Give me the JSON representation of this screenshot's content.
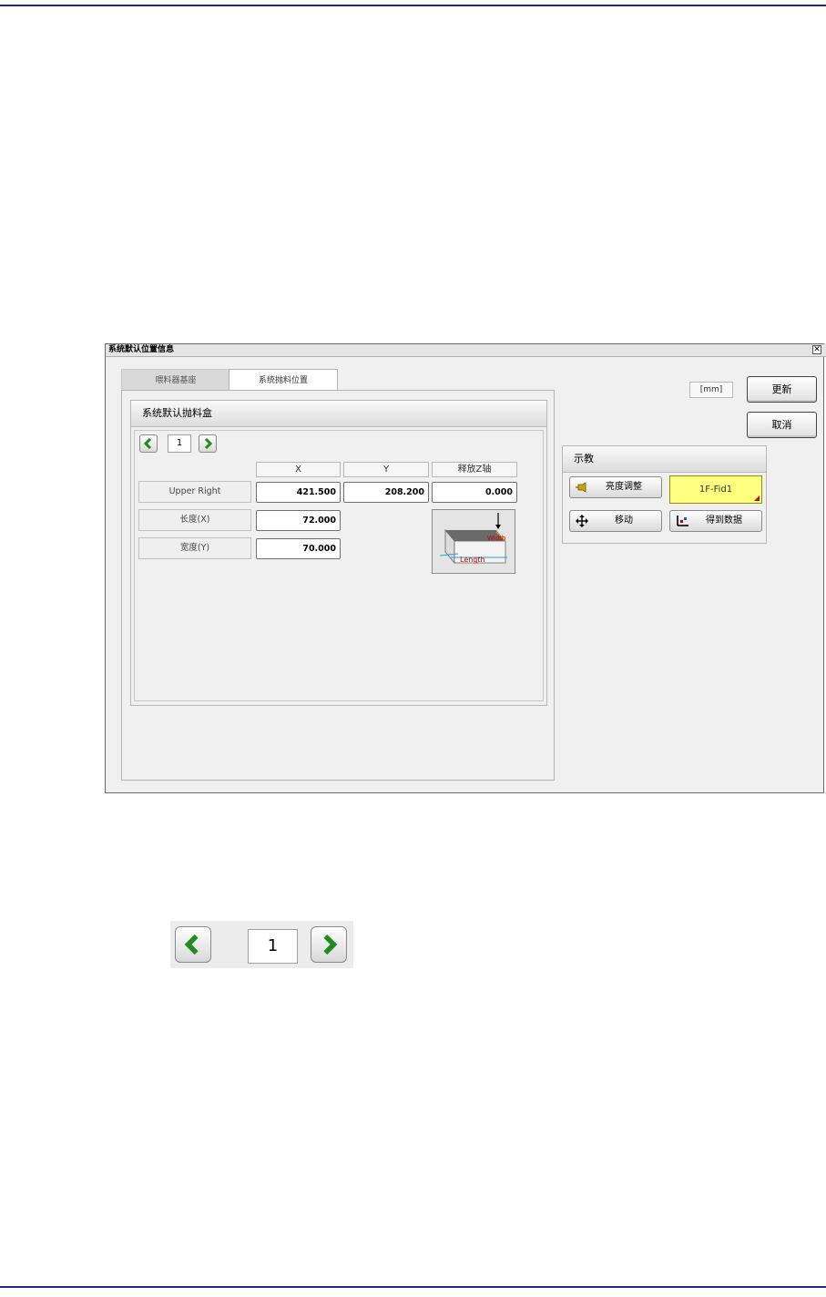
{
  "dialog": {
    "title": "系统默认位置信息",
    "close_glyph": "✕",
    "tabs": [
      {
        "label": "喂料器基座",
        "active": false
      },
      {
        "label": "系统抛料位置",
        "active": true
      }
    ],
    "group_title": "系统默认抛料盒",
    "nav": {
      "prev_glyph": "‹",
      "value": "1",
      "next_glyph": "›"
    },
    "columns": [
      "X",
      "Y",
      "释放Z轴"
    ],
    "rows": [
      {
        "label": "Upper Right",
        "x": "421.500",
        "y": "208.200",
        "z": "0.000"
      },
      {
        "label": "长度(X)",
        "x": "72.000"
      },
      {
        "label": "宽度(Y)",
        "x": "70.000"
      }
    ],
    "illustration": {
      "length_label": "Length",
      "width_label": "Width"
    },
    "unit_label": "[mm]",
    "update_button": "更新",
    "cancel_button": "取消",
    "teach": {
      "title": "示教",
      "brightness_button": "亮度调整",
      "fid_label": "1F-Fid1",
      "move_button": "移动",
      "get_data_button": "得到数据"
    }
  },
  "zoom_nav": {
    "value": "1"
  },
  "colors": {
    "rule": "#1c2a8c",
    "accent_green": "#1e8c1e",
    "fid_bg": "#ffff80"
  }
}
